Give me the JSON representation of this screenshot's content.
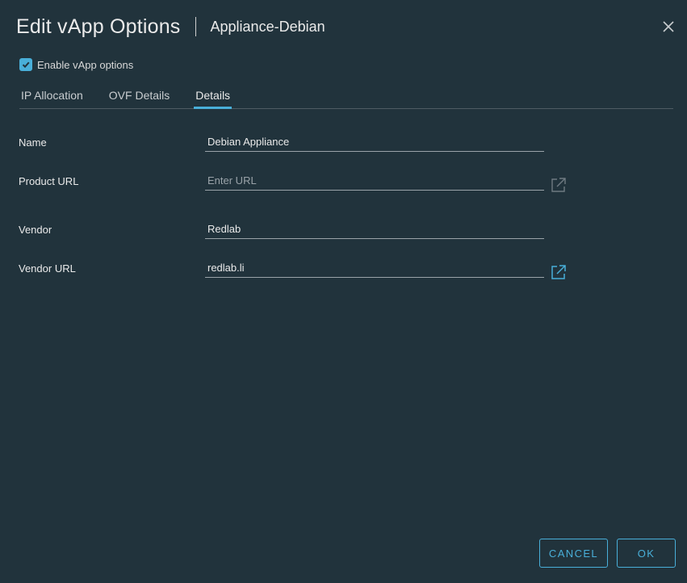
{
  "header": {
    "title": "Edit vApp Options",
    "subtitle": "Appliance-Debian",
    "close_icon": "close-icon"
  },
  "enable_vapp": {
    "label": "Enable vApp options",
    "checked": true
  },
  "tabs": [
    {
      "label": "IP Allocation",
      "active": false
    },
    {
      "label": "OVF Details",
      "active": false
    },
    {
      "label": "Details",
      "active": true
    }
  ],
  "form": {
    "name": {
      "label": "Name",
      "value": "Debian Appliance",
      "placeholder": ""
    },
    "product_url": {
      "label": "Product URL",
      "value": "",
      "placeholder": "Enter URL",
      "link_icon": "external-link-icon",
      "link_enabled": false
    },
    "vendor": {
      "label": "Vendor",
      "value": "Redlab",
      "placeholder": ""
    },
    "vendor_url": {
      "label": "Vendor URL",
      "value": "redlab.li",
      "placeholder": "",
      "link_icon": "external-link-icon",
      "link_enabled": true
    }
  },
  "footer": {
    "cancel_label": "CANCEL",
    "ok_label": "OK"
  },
  "colors": {
    "background": "#21333c",
    "accent": "#49afd9",
    "disabled_icon": "#7a868d"
  }
}
